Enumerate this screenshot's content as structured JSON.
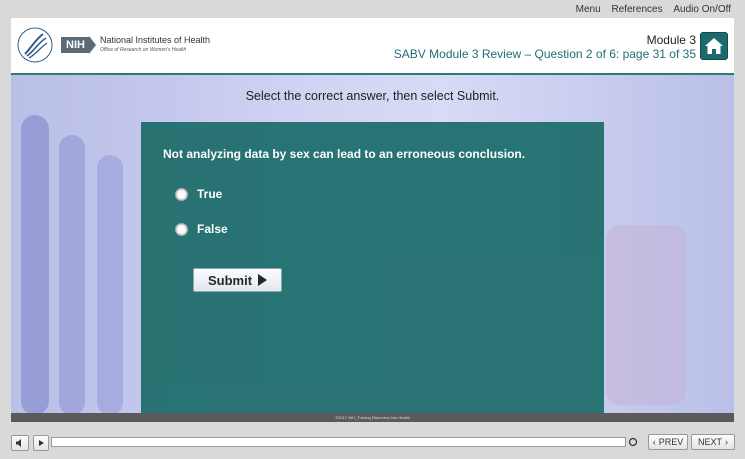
{
  "top_menu": {
    "menu": "Menu",
    "references": "References",
    "audio": "Audio On/Off"
  },
  "header": {
    "nih_abbrev": "NIH",
    "nih_name": "National Institutes of Health",
    "nih_office": "Office of Research on Women's Health",
    "module": "Module 3",
    "subtitle": "SABV Module 3 Review – Question 2 of 6: page 31 of 35"
  },
  "instruction": "Select the correct answer, then select Submit.",
  "question": {
    "text": "Not analyzing data by sex can lead to an erroneous conclusion.",
    "options": [
      "True",
      "False"
    ],
    "selected": null
  },
  "submit_label": "Submit",
  "footer_text": "©2017 NIH_Turning Discovery Into Health",
  "controls": {
    "prev": "PREV",
    "next": "NEXT",
    "progress": 0
  },
  "colors": {
    "teal": "#23706f",
    "accent": "#1f6e75"
  },
  "icons": [
    "hhs-logo-icon",
    "home-icon",
    "volume-icon",
    "play-icon",
    "replay-icon",
    "chevron-left-icon",
    "chevron-right-icon"
  ]
}
